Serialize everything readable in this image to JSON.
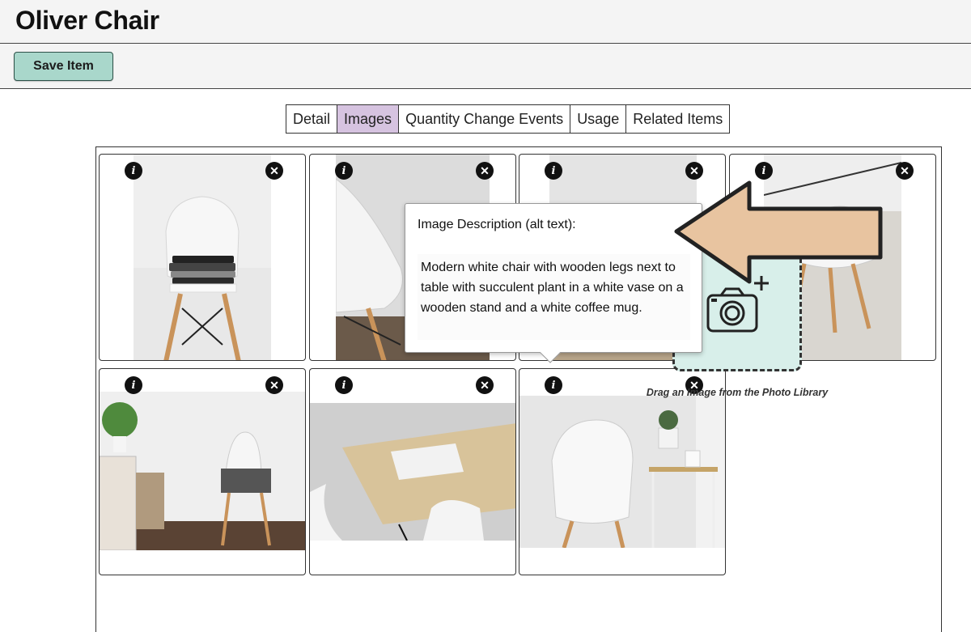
{
  "page": {
    "title": "Oliver Chair"
  },
  "toolbar": {
    "save_label": "Save Item"
  },
  "tabs": [
    {
      "label": "Detail",
      "active": false
    },
    {
      "label": "Images",
      "active": true
    },
    {
      "label": "Quantity Change Events",
      "active": false
    },
    {
      "label": "Usage",
      "active": false
    },
    {
      "label": "Related Items",
      "active": false
    }
  ],
  "images": [
    {
      "subject": "chair with folded clothes",
      "info_icon": "info-icon",
      "remove_icon": "close-icon"
    },
    {
      "subject": "chair close-up",
      "info_icon": "info-icon",
      "remove_icon": "close-icon"
    },
    {
      "subject": "chair by table",
      "info_icon": "info-icon",
      "remove_icon": "close-icon"
    },
    {
      "subject": "chair on tile floor",
      "info_icon": "info-icon",
      "remove_icon": "close-icon"
    },
    {
      "subject": "chair with shoes and plant",
      "info_icon": "info-icon",
      "remove_icon": "close-icon"
    },
    {
      "subject": "table with chairs",
      "info_icon": "info-icon",
      "remove_icon": "close-icon"
    },
    {
      "subject": "chair with plant stand",
      "info_icon": "info-icon",
      "remove_icon": "close-icon"
    }
  ],
  "tooltip": {
    "title": "Image Description (alt text):",
    "body": "Modern white chair with wooden legs next to table with succulent plant in a white vase on a wooden stand and a white coffee mug."
  },
  "upload": {
    "label": "Drag an Image from the Photo Library",
    "icon": "camera-plus-icon"
  },
  "colors": {
    "save_button_bg": "#a9d7cb",
    "active_tab_bg": "#d6c3e0",
    "drop_zone_bg": "#d8efea",
    "arrow_fill": "#e8c4a0"
  }
}
